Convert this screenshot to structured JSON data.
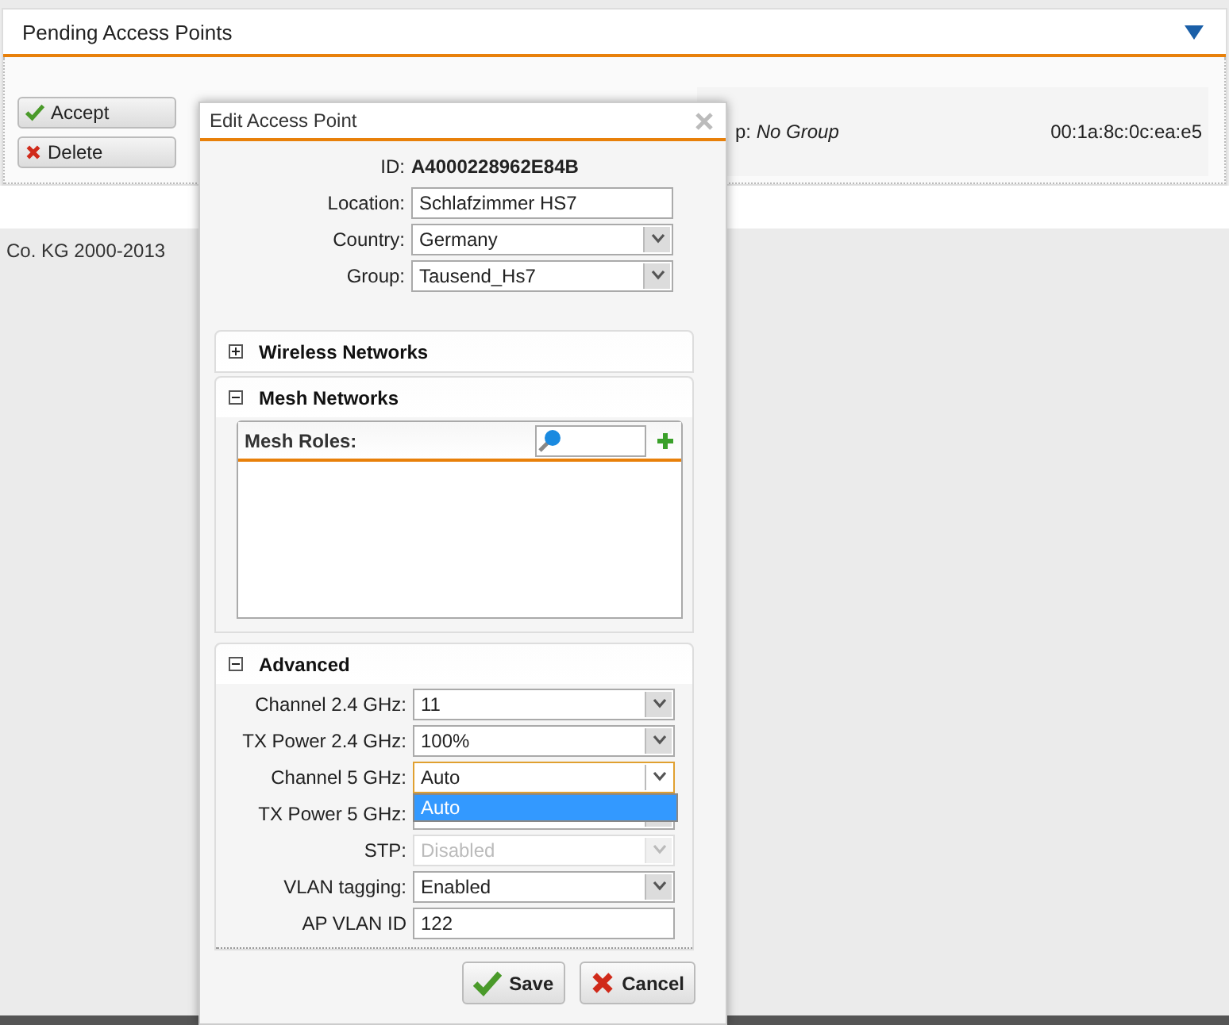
{
  "panel": {
    "title": "Pending Access Points",
    "expanded": true
  },
  "actions": [
    {
      "kind": "accept",
      "label": "Accept"
    },
    {
      "kind": "delete",
      "label": "Delete"
    }
  ],
  "pending_row": {
    "group_text": "p: *No Group*",
    "mac": "00:1a:8c:0c:ea:e5"
  },
  "footer_text": "Co. KG 2000-2013",
  "dialog": {
    "title": "Edit Access Point",
    "id_label": "ID:",
    "id_value": "A4000228962E84B",
    "fields": [
      {
        "kind": "text",
        "label": "Location:",
        "value": "Schlafzimmer HS7"
      },
      {
        "kind": "select",
        "label": "Country:",
        "value": "Germany"
      },
      {
        "kind": "select",
        "label": "Group:",
        "value": "Tausend_Hs7"
      }
    ],
    "sections": [
      {
        "kind": "plain",
        "title": "Wireless Networks",
        "expanded": false
      },
      {
        "kind": "list",
        "title": "Mesh Networks",
        "expanded": true,
        "list_title": "Mesh Roles:"
      },
      {
        "kind": "form",
        "title": "Advanced",
        "expanded": true,
        "fields": [
          {
            "kind": "select",
            "label": "Channel 2.4 GHz:",
            "value": "11",
            "disabled": false,
            "focused": false
          },
          {
            "kind": "select",
            "label": "TX Power 2.4 GHz:",
            "value": "100%",
            "disabled": false,
            "focused": false
          },
          {
            "kind": "select",
            "label": "Channel 5 GHz:",
            "value": "Auto",
            "disabled": false,
            "focused": true,
            "options": [
              {
                "label": "Auto",
                "selected": true
              }
            ]
          },
          {
            "kind": "select",
            "label": "TX Power 5 GHz:",
            "disabled": false,
            "focused": false
          },
          {
            "kind": "select",
            "label": "STP:",
            "value": "Disabled",
            "disabled": true,
            "focused": false
          },
          {
            "kind": "select",
            "label": "VLAN tagging:",
            "value": "Enabled",
            "disabled": false,
            "focused": false
          },
          {
            "kind": "text",
            "label": "AP VLAN ID",
            "value": "122",
            "disabled": false,
            "focused": false
          }
        ]
      }
    ],
    "buttons": [
      {
        "kind": "save",
        "label": "Save"
      },
      {
        "kind": "cancel",
        "label": "Cancel"
      }
    ]
  }
}
